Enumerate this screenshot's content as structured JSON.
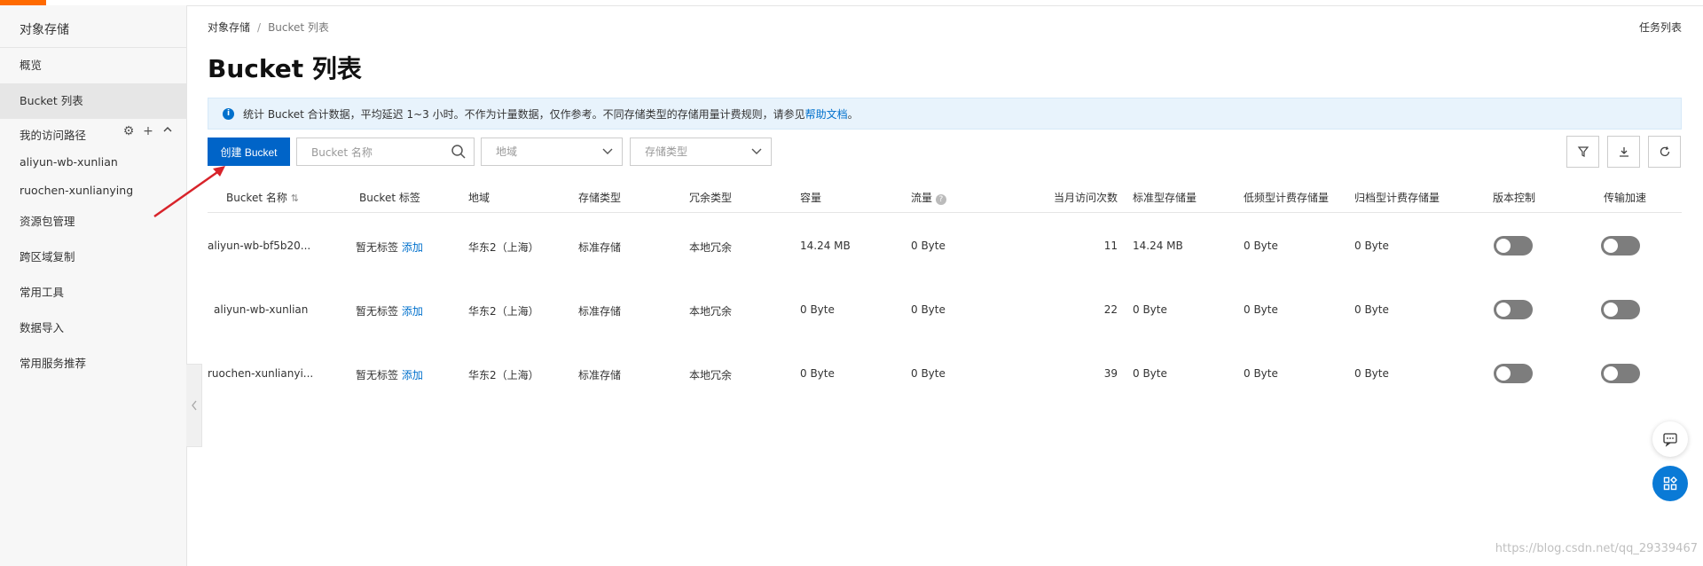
{
  "sidebar": {
    "title": "对象存储",
    "items": [
      {
        "label": "概览"
      },
      {
        "label": "Bucket 列表"
      }
    ],
    "path_label": "我的访问路径",
    "paths": [
      "aliyun-wb-xunlian",
      "ruochen-xunlianying"
    ],
    "more_items": [
      {
        "label": "资源包管理"
      },
      {
        "label": "跨区域复制"
      },
      {
        "label": "常用工具"
      },
      {
        "label": "数据导入"
      },
      {
        "label": "常用服务推荐"
      }
    ]
  },
  "breadcrumb": {
    "root": "对象存储",
    "separator": "/",
    "current": "Bucket 列表"
  },
  "task_list": "任务列表",
  "page_title": "Bucket 列表",
  "notice": {
    "text": "统计 Bucket 合计数据，平均延迟 1~3 小时。不作为计量数据，仅作参考。不同存储类型的存储用量计费规则，请参见",
    "link": "帮助文档",
    "tail": "。"
  },
  "toolbar": {
    "create_label": "创建 Bucket",
    "search_placeholder": "Bucket 名称",
    "region_placeholder": "地域",
    "storage_type_placeholder": "存储类型"
  },
  "table": {
    "headers": [
      "Bucket 名称",
      "Bucket 标签",
      "地域",
      "存储类型",
      "冗余类型",
      "容量",
      "流量",
      "当月访问次数",
      "标准型存储量",
      "低频型计费存储量",
      "归档型计费存储量",
      "版本控制",
      "传输加速"
    ],
    "rows": [
      {
        "name": "aliyun-wb-bf5b20...",
        "tag": "暂无标签",
        "tag_action": "添加",
        "region": "华东2（上海）",
        "storage": "标准存储",
        "redundancy": "本地冗余",
        "capacity": "14.24 MB",
        "traffic": "0 Byte",
        "visits": "11",
        "standard": "14.24 MB",
        "ia": "0 Byte",
        "archive": "0 Byte"
      },
      {
        "name": "aliyun-wb-xunlian",
        "tag": "暂无标签",
        "tag_action": "添加",
        "region": "华东2（上海）",
        "storage": "标准存储",
        "redundancy": "本地冗余",
        "capacity": "0 Byte",
        "traffic": "0 Byte",
        "visits": "22",
        "standard": "0 Byte",
        "ia": "0 Byte",
        "archive": "0 Byte"
      },
      {
        "name": "ruochen-xunlianyi...",
        "tag": "暂无标签",
        "tag_action": "添加",
        "region": "华东2（上海）",
        "storage": "标准存储",
        "redundancy": "本地冗余",
        "capacity": "0 Byte",
        "traffic": "0 Byte",
        "visits": "39",
        "standard": "0 Byte",
        "ia": "0 Byte",
        "archive": "0 Byte"
      }
    ]
  },
  "watermark": "https://blog.csdn.net/qq_29339467",
  "colors": {
    "primary": "#0064c8",
    "accent": "#ff6a00",
    "annotation": "#d8232a"
  }
}
